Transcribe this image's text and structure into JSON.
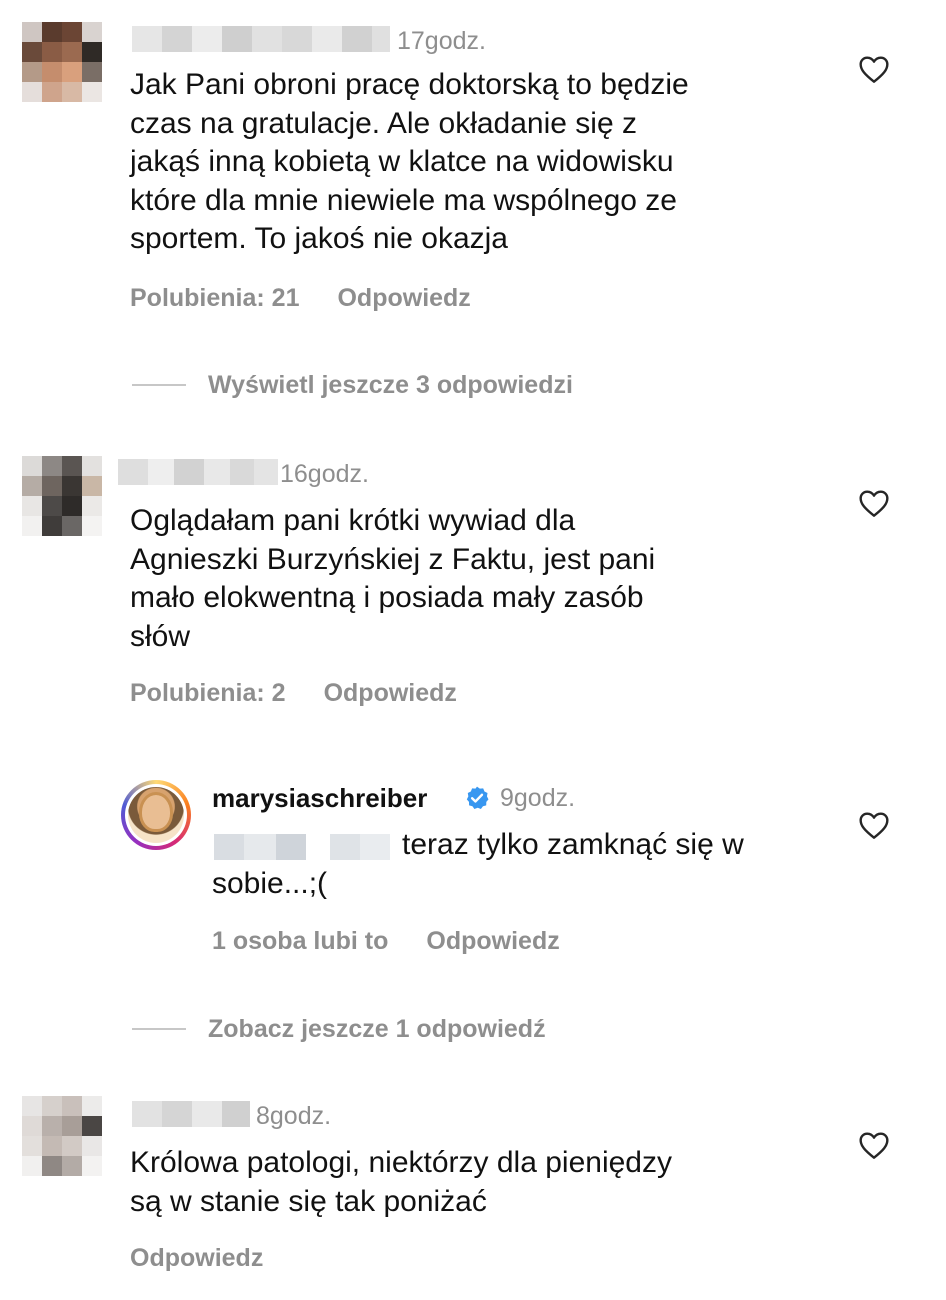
{
  "comments": [
    {
      "time": "17godz.",
      "text_lines": [
        "Jak Pani obroni pracę doktorską to będzie",
        "czas na gratulacje. Ale okładanie się z",
        "jakąś inną kobietą w klatce na widowisku",
        "które dla mnie niewiele ma wspólnego ze",
        "sportem. To jakoś nie okazja"
      ],
      "likes_label": "Polubienia: 21",
      "reply_label": "Odpowiedz",
      "view_more": "Wyświetl jeszcze 3 odpowiedzi"
    },
    {
      "time": "16godz.",
      "text_lines": [
        "Oglądałam pani krótki wywiad dla",
        "Agnieszki Burzyńskiej z Faktu, jest pani",
        "mało elokwentną i  posiada mały zasób",
        "słów"
      ],
      "likes_label": "Polubienia: 2",
      "reply_label": "Odpowiedz",
      "reply": {
        "username": "marysiaschreiber",
        "time": "9godz.",
        "text_lines": [
          "teraz tylko zamknąć się w",
          "sobie...;("
        ],
        "likes_label": "1 osoba lubi to",
        "reply_label": "Odpowiedz"
      },
      "view_more": "Zobacz jeszcze 1 odpowiedź"
    },
    {
      "time": "8godz.",
      "text_lines": [
        "Królowa patologi, niektórzy dla pieniędzy",
        "są w stanie się tak poniżać"
      ],
      "reply_label": "Odpowiedz"
    }
  ],
  "icons": {
    "like": "heart-outline-icon",
    "verified": "verified-badge-icon"
  },
  "colors": {
    "secondary_text": "#8e8e8e",
    "verified_blue": "#3897f0"
  }
}
